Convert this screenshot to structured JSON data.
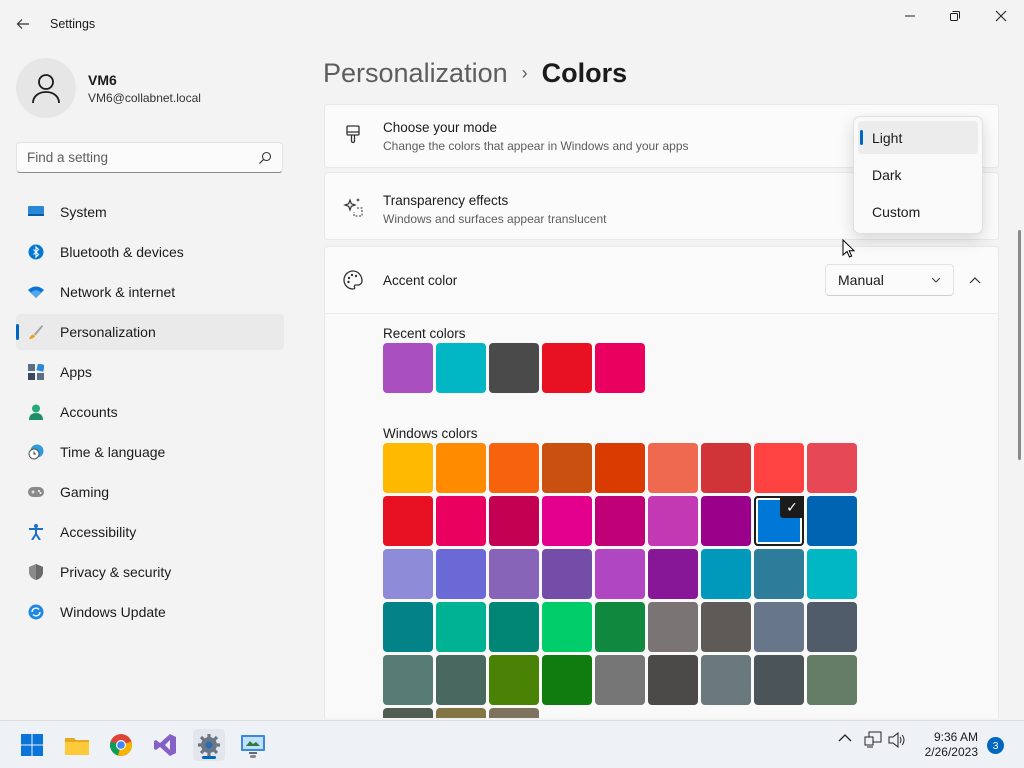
{
  "window": {
    "title": "Settings",
    "back_icon": "arrow-left-icon",
    "min_icon": "minimize-icon",
    "max_icon": "restore-icon",
    "close_icon": "close-icon"
  },
  "profile": {
    "name": "VM6",
    "email": "VM6@collabnet.local"
  },
  "search": {
    "placeholder": "Find a setting"
  },
  "sidebar": {
    "items": [
      {
        "label": "System",
        "icon": "monitor-icon",
        "active": false
      },
      {
        "label": "Bluetooth & devices",
        "icon": "bluetooth-icon",
        "active": false
      },
      {
        "label": "Network & internet",
        "icon": "wifi-icon",
        "active": false
      },
      {
        "label": "Personalization",
        "icon": "brush-icon",
        "active": true
      },
      {
        "label": "Apps",
        "icon": "apps-icon",
        "active": false
      },
      {
        "label": "Accounts",
        "icon": "person-icon",
        "active": false
      },
      {
        "label": "Time & language",
        "icon": "clock-globe-icon",
        "active": false
      },
      {
        "label": "Gaming",
        "icon": "gamepad-icon",
        "active": false
      },
      {
        "label": "Accessibility",
        "icon": "accessibility-icon",
        "active": false
      },
      {
        "label": "Privacy & security",
        "icon": "shield-icon",
        "active": false
      },
      {
        "label": "Windows Update",
        "icon": "update-icon",
        "active": false
      }
    ]
  },
  "breadcrumb": {
    "parent": "Personalization",
    "separator": "›",
    "current": "Colors"
  },
  "mode_card": {
    "title": "Choose your mode",
    "description": "Change the colors that appear in Windows and your apps"
  },
  "mode_dropdown": {
    "options": [
      "Light",
      "Dark",
      "Custom"
    ],
    "selected": "Light"
  },
  "transparency_card": {
    "title": "Transparency effects",
    "description": "Windows and surfaces appear translucent"
  },
  "accent_card": {
    "title": "Accent color",
    "dropdown_value": "Manual"
  },
  "recent_colors": {
    "label": "Recent colors",
    "colors": [
      "#a94fc0",
      "#00b7c3",
      "#4a4a4a",
      "#e81123",
      "#ea005e"
    ]
  },
  "windows_colors": {
    "label": "Windows colors",
    "selected": "#0078d7",
    "colors": [
      "#ffb900",
      "#ff8c00",
      "#f7630c",
      "#ca5010",
      "#da3b01",
      "#ef6950",
      "#d13438",
      "#ff4343",
      "#e74856",
      "#e81123",
      "#ea005e",
      "#c30052",
      "#e3008c",
      "#bf0077",
      "#c239b3",
      "#9a0089",
      "#0078d7",
      "#0063b1",
      "#8e8cd8",
      "#6b69d6",
      "#8764b8",
      "#744da9",
      "#b146c2",
      "#881798",
      "#0099bc",
      "#2d7d9a",
      "#00b7c3",
      "#038387",
      "#00b294",
      "#018574",
      "#00cc6a",
      "#10893e",
      "#7a7574",
      "#5d5a58",
      "#68768a",
      "#515c6b",
      "#567c73",
      "#486860",
      "#498205",
      "#107c10",
      "#767676",
      "#4c4a48",
      "#69797e",
      "#4a5459",
      "#647c64",
      "#525e54",
      "#847545",
      "#7e735f"
    ]
  },
  "taskbar": {
    "apps": [
      "start-icon",
      "file-explorer-icon",
      "chrome-icon",
      "visual-studio-icon",
      "settings-icon",
      "remote-desktop-icon"
    ],
    "time": "9:36 AM",
    "date": "2/26/2023",
    "notifications": "3"
  }
}
